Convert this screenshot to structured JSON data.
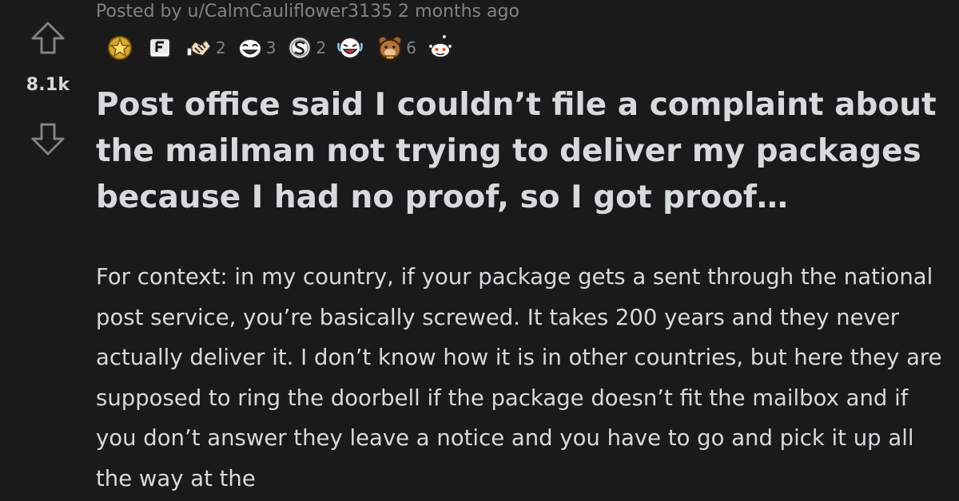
{
  "post": {
    "score": "8.1k",
    "meta": {
      "posted_by_prefix": "Posted by ",
      "username": "u/CalmCauliflower3135",
      "time_ago": " 2 months ago"
    },
    "awards": [
      {
        "icon": "gold-star-award-icon",
        "count": ""
      },
      {
        "icon": "f-key-award-icon",
        "count": ""
      },
      {
        "icon": "handshake-award-icon",
        "count": "2"
      },
      {
        "icon": "laughing-face-award-icon",
        "count": "3"
      },
      {
        "icon": "silver-s-award-icon",
        "count": "2"
      },
      {
        "icon": "crying-laughing-face-award-icon",
        "count": ""
      },
      {
        "icon": "bear-face-award-icon",
        "count": "6"
      },
      {
        "icon": "snoo-award-icon",
        "count": ""
      }
    ],
    "title": "Post office said I couldn’t file a complaint about the mailman not trying to deliver my packages because I had no proof, so I got proof…",
    "body": "For context: in my country, if your package gets a sent through the national post service, you’re basically screwed. It takes 200 years and they never actually deliver it. I don’t know how it is in other countries, but here they are supposed to ring the doorbell if the package doesn’t fit the mailbox and if you don’t answer they leave a notice and you have to go and pick it up all the way at the"
  },
  "colors": {
    "background": "#1a1a1b",
    "text": "#d7dadc",
    "meta_text": "#818384"
  }
}
